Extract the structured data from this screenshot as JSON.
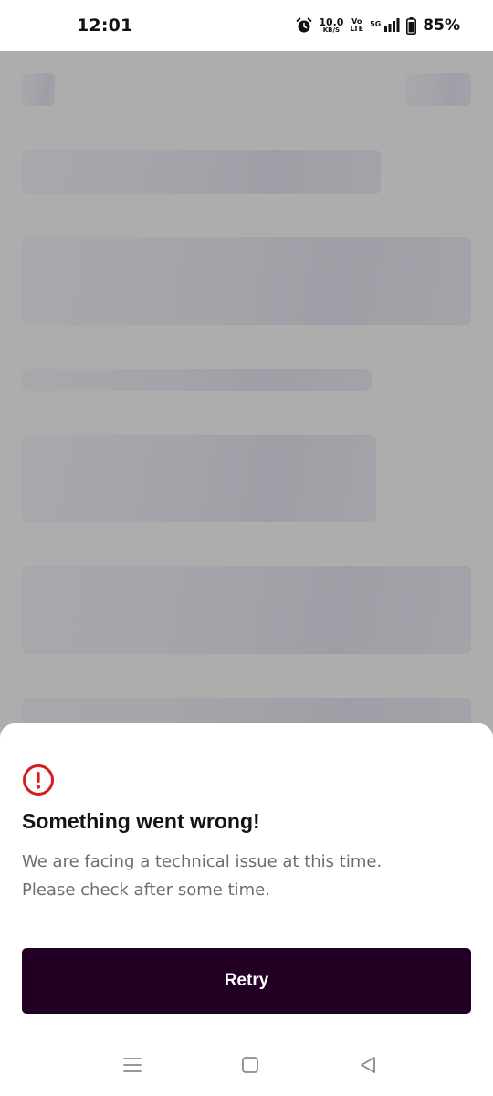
{
  "status_bar": {
    "time": "12:01",
    "speed_value": "10.0",
    "speed_unit": "KB/S",
    "volte_top": "Vo",
    "volte_bottom": "LTE",
    "network": "5G",
    "battery": "85%",
    "icons": [
      "alarm-icon",
      "signal-icon",
      "battery-icon"
    ]
  },
  "error_sheet": {
    "icon": "alert-circle-icon",
    "title": "Something went wrong!",
    "message_lines": [
      "We are facing a technical issue at this time.",
      "Please check after some time."
    ],
    "retry_label": "Retry"
  },
  "nav_bar": {
    "icons": [
      "menu-icon",
      "home-icon",
      "back-icon"
    ]
  },
  "colors": {
    "alert_red": "#d81b1b",
    "button_bg": "#220025",
    "overlay_gray": "#adadad"
  }
}
